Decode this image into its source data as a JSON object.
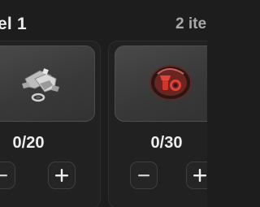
{
  "header": {
    "level_title": "el 1",
    "item_count": "2 ite"
  },
  "cards": [
    {
      "icon": "metal-bracket-icon",
      "counter": "0/20",
      "minus_icon": "minus-icon",
      "plus_icon": "plus-icon"
    },
    {
      "icon": "red-valve-icon",
      "counter": "0/30",
      "minus_icon": "minus-icon",
      "plus_icon": "plus-icon"
    }
  ],
  "colors": {
    "background": "#1e1d1d",
    "card": "#222121",
    "thumb": "#3f3e3e",
    "accent_red": "#c0302a"
  }
}
